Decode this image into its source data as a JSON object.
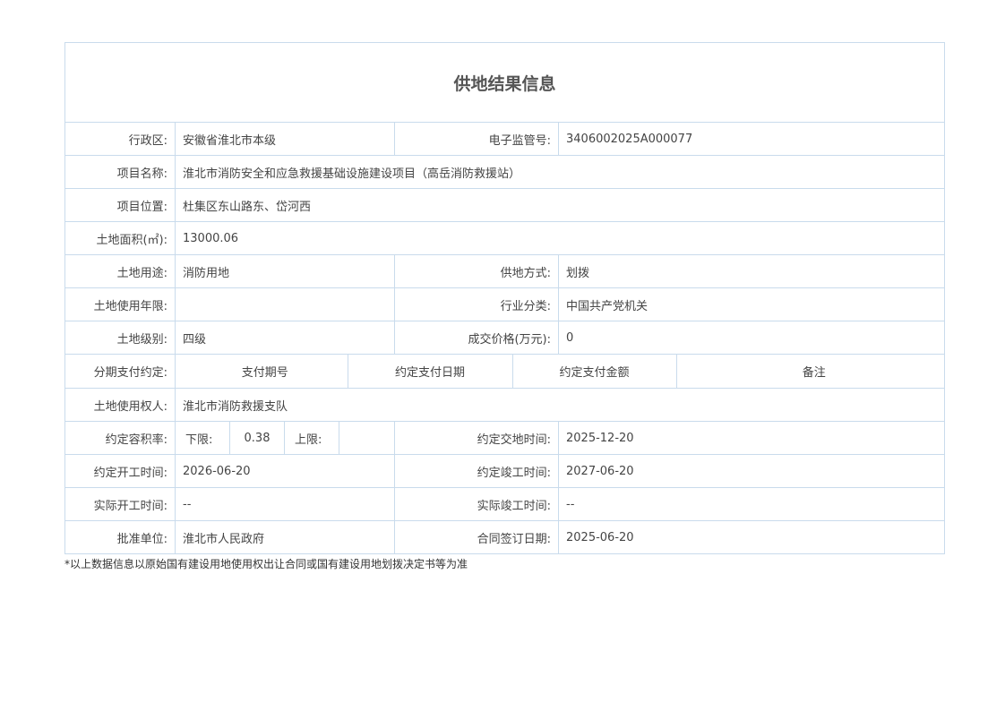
{
  "title": "供地结果信息",
  "rows": {
    "region_label": "行政区:",
    "region_value": "安徽省淮北市本级",
    "supervision_label": "电子监管号:",
    "supervision_value": "3406002025A000077",
    "project_name_label": "项目名称:",
    "project_name_value": "淮北市消防安全和应急救援基础设施建设项目（高岳消防救援站）",
    "project_location_label": "项目位置:",
    "project_location_value": "杜集区东山路东、岱河西",
    "land_area_label": "土地面积(㎡):",
    "land_area_value": "13000.06",
    "land_use_label": "土地用途:",
    "land_use_value": "消防用地",
    "supply_method_label": "供地方式:",
    "supply_method_value": "划拨",
    "use_term_label": "土地使用年限:",
    "use_term_value": "",
    "industry_label": "行业分类:",
    "industry_value": "中国共产党机关",
    "land_grade_label": "土地级别:",
    "land_grade_value": "四级",
    "price_label": "成交价格(万元):",
    "price_value": "0",
    "installment_label": "分期支付约定:",
    "installment_headers": [
      "支付期号",
      "约定支付日期",
      "约定支付金额",
      "备注"
    ],
    "right_holder_label": "土地使用权人:",
    "right_holder_value": "淮北市消防救援支队",
    "far_label": "约定容积率:",
    "far_lower_label": "下限:",
    "far_lower_value": "0.38",
    "far_upper_label": "上限:",
    "far_upper_value": "",
    "delivery_time_label": "约定交地时间:",
    "delivery_time_value": "2025-12-20",
    "start_time_label": "约定开工时间:",
    "start_time_value": "2026-06-20",
    "complete_time_label": "约定竣工时间:",
    "complete_time_value": "2027-06-20",
    "actual_start_label": "实际开工时间:",
    "actual_start_value": "--",
    "actual_complete_label": "实际竣工时间:",
    "actual_complete_value": "--",
    "approval_unit_label": "批准单位:",
    "approval_unit_value": "淮北市人民政府",
    "contract_date_label": "合同签订日期:",
    "contract_date_value": "2025-06-20"
  },
  "footnote": "*以上数据信息以原始国有建设用地使用权出让合同或国有建设用地划拨决定书等为准",
  "colors": {
    "border": "#c9dbec",
    "text": "#444444"
  }
}
